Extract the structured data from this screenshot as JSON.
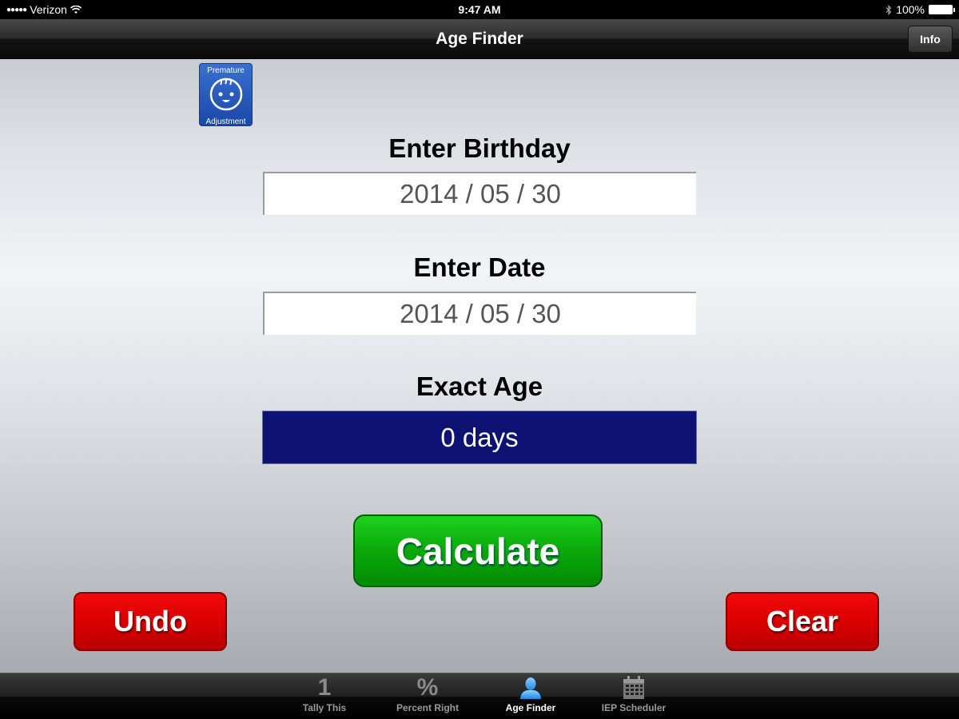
{
  "status_bar": {
    "carrier": "Verizon",
    "signal_dots": "●●●●●",
    "time": "9:47 AM",
    "battery": "100%"
  },
  "nav": {
    "title": "Age Finder",
    "info_label": "Info"
  },
  "premature_button": {
    "top_text": "Premature",
    "bottom_text": "Adjustment"
  },
  "form": {
    "birthday_label": "Enter Birthday",
    "birthday_value": "2014 / 05 / 30",
    "date_label": "Enter Date",
    "date_value": "2014 / 05 / 30",
    "age_label": "Exact Age",
    "age_value": "0 days"
  },
  "buttons": {
    "calculate": "Calculate",
    "undo": "Undo",
    "clear": "Clear"
  },
  "colors": {
    "age_field_bg": "#0e1273",
    "calculate_green": "#0aa80a",
    "red_button": "#d80000",
    "active_tab_icon": "#3ea6f2"
  },
  "tabs": [
    {
      "label": "Tally This",
      "icon": "1",
      "active": false
    },
    {
      "label": "Percent Right",
      "icon": "%",
      "active": false
    },
    {
      "label": "Age Finder",
      "icon": "person-icon",
      "active": true
    },
    {
      "label": "IEP Scheduler",
      "icon": "calendar-icon",
      "active": false
    }
  ]
}
